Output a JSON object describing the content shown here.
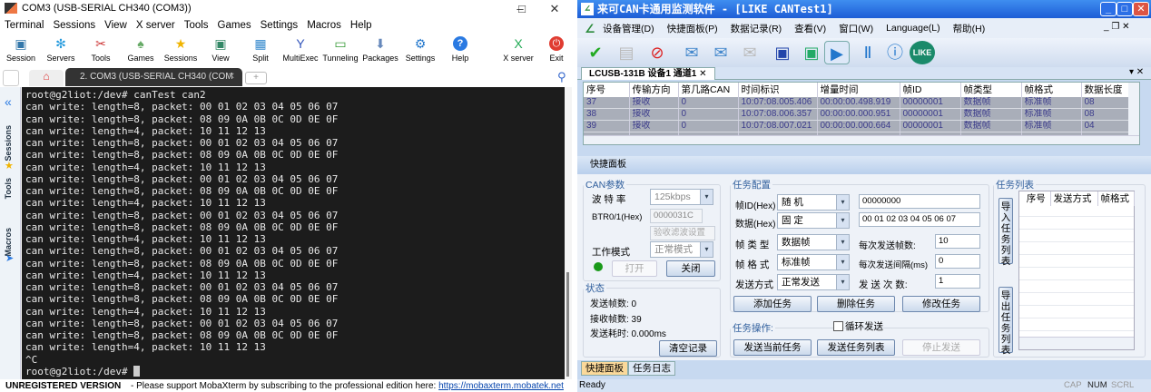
{
  "moba": {
    "title": "COM3  (USB-SERIAL CH340 (COM3))",
    "menu": [
      "Terminal",
      "Sessions",
      "View",
      "X server",
      "Tools",
      "Games",
      "Settings",
      "Macros",
      "Help"
    ],
    "toolbar": [
      {
        "label": "Session",
        "icon": "monitor-icon"
      },
      {
        "label": "Servers",
        "icon": "servers-icon"
      },
      {
        "label": "Tools",
        "icon": "tools-icon"
      },
      {
        "label": "Games",
        "icon": "gamepad-icon"
      },
      {
        "label": "Sessions",
        "icon": "star-icon"
      },
      {
        "label": "View",
        "icon": "view-icon"
      },
      {
        "label": "Split",
        "icon": "split-icon"
      },
      {
        "label": "MultiExec",
        "icon": "fork-icon"
      },
      {
        "label": "Tunneling",
        "icon": "tunnel-icon"
      },
      {
        "label": "Packages",
        "icon": "package-icon"
      },
      {
        "label": "Settings",
        "icon": "gear-icon"
      },
      {
        "label": "Help",
        "icon": "help-icon"
      },
      {
        "label": "X server",
        "icon": "x-icon"
      },
      {
        "label": "Exit",
        "icon": "power-icon"
      }
    ],
    "tab_label": "2. COM3  (USB-SERIAL CH340 (COM",
    "side_tabs": [
      "Sessions",
      "Tools",
      "Macros"
    ],
    "terminal_lines": [
      "root@g2liot:/dev# canTest can2",
      "can write: length=8, packet: 00 01 02 03 04 05 06 07",
      "can write: length=8, packet: 08 09 0A 0B 0C 0D 0E 0F",
      "can write: length=4, packet: 10 11 12 13",
      "can write: length=8, packet: 00 01 02 03 04 05 06 07",
      "can write: length=8, packet: 08 09 0A 0B 0C 0D 0E 0F",
      "can write: length=4, packet: 10 11 12 13",
      "can write: length=8, packet: 00 01 02 03 04 05 06 07",
      "can write: length=8, packet: 08 09 0A 0B 0C 0D 0E 0F",
      "can write: length=4, packet: 10 11 12 13",
      "can write: length=8, packet: 00 01 02 03 04 05 06 07",
      "can write: length=8, packet: 08 09 0A 0B 0C 0D 0E 0F",
      "can write: length=4, packet: 10 11 12 13",
      "can write: length=8, packet: 00 01 02 03 04 05 06 07",
      "can write: length=8, packet: 08 09 0A 0B 0C 0D 0E 0F",
      "can write: length=4, packet: 10 11 12 13",
      "can write: length=8, packet: 00 01 02 03 04 05 06 07",
      "can write: length=8, packet: 08 09 0A 0B 0C 0D 0E 0F",
      "can write: length=4, packet: 10 11 12 13",
      "can write: length=8, packet: 00 01 02 03 04 05 06 07",
      "can write: length=8, packet: 08 09 0A 0B 0C 0D 0E 0F",
      "can write: length=4, packet: 10 11 12 13",
      "^C"
    ],
    "prompt": "root@g2liot:/dev# ",
    "status_bold": "UNREGISTERED VERSION",
    "status_text": " -  Please support MobaXterm by subscribing to the professional edition here:  ",
    "status_link": "https://mobaxterm.mobatek.net"
  },
  "can": {
    "title": "来可CAN卡通用监测软件 - [LIKE CANTest1]",
    "menu": [
      "设备管理(D)",
      "快捷面板(P)",
      "数据记录(R)",
      "查看(V)",
      "窗口(W)",
      "Language(L)",
      "帮助(H)"
    ],
    "doc_tab": "LCUSB-131B 设备1 通道1",
    "columns": [
      "序号",
      "传输方向",
      "第几路CAN",
      "时间标识",
      "增量时间",
      "帧ID",
      "帧类型",
      "帧格式",
      "数据长度"
    ],
    "rows": [
      [
        "37",
        "接收",
        "0",
        "10:07:08.005.406",
        "00:00:00.498.919",
        "00000001",
        "数据帧",
        "标准帧",
        "08"
      ],
      [
        "38",
        "接收",
        "0",
        "10:07:08.006.357",
        "00:00:00.000.951",
        "00000001",
        "数据帧",
        "标准帧",
        "08"
      ],
      [
        "39",
        "接收",
        "0",
        "10:07:08.007.021",
        "00:00:00.000.664",
        "00000001",
        "数据帧",
        "标准帧",
        "04"
      ]
    ],
    "quick_panel": "快捷面板",
    "can_params": {
      "legend": "CAN参数",
      "baud_label": "波 特 率",
      "baud": "125kbps",
      "btr_label": "BTR0/1(Hex)",
      "btr": "0000031C",
      "filter_btn": "验收滤波设置",
      "mode_label": "工作模式",
      "mode": "正常模式",
      "open": "打开",
      "close": "关闭",
      "led_color": "#1a9a1a"
    },
    "state": {
      "legend": "状态",
      "sent": "发送帧数: 0",
      "recv": "接收帧数: 39",
      "time": "发送耗时: 0.000ms",
      "clear": "清空记录"
    },
    "task_cfg": {
      "legend": "任务配置",
      "id_label": "帧ID(Hex)",
      "id_mode": "随    机",
      "id_value": "00000000",
      "data_label": "数据(Hex)",
      "data_mode": "固    定",
      "data_value": "00 01 02 03 04 05 06 07",
      "type_label": "帧 类 型",
      "type": "数据帧",
      "fmt_label": "帧 格 式",
      "fmt": "标准帧",
      "send_label": "发送方式",
      "send": "正常发送",
      "per_label": "每次发送帧数:",
      "per": "10",
      "interval_label": "每次发送间隔(ms)",
      "interval": "0",
      "count_label": "发 送 次 数:",
      "count": "1",
      "add": "添加任务",
      "del": "删除任务",
      "mod": "修改任务"
    },
    "task_op": {
      "legend": "任务操作:",
      "loop": "循环发送",
      "loop_checked": false,
      "send_cur": "发送当前任务",
      "send_list": "发送任务列表",
      "stop": "停止发送"
    },
    "task_list": {
      "legend": "任务列表",
      "import": "导入任务列表",
      "export": "导出任务列表",
      "columns": [
        "序号",
        "发送方式",
        "帧格式"
      ]
    },
    "bottom_tabs": [
      "快捷面板",
      "任务日志"
    ],
    "status": "Ready",
    "indicators": [
      "CAP",
      "NUM",
      "SCRL"
    ]
  }
}
